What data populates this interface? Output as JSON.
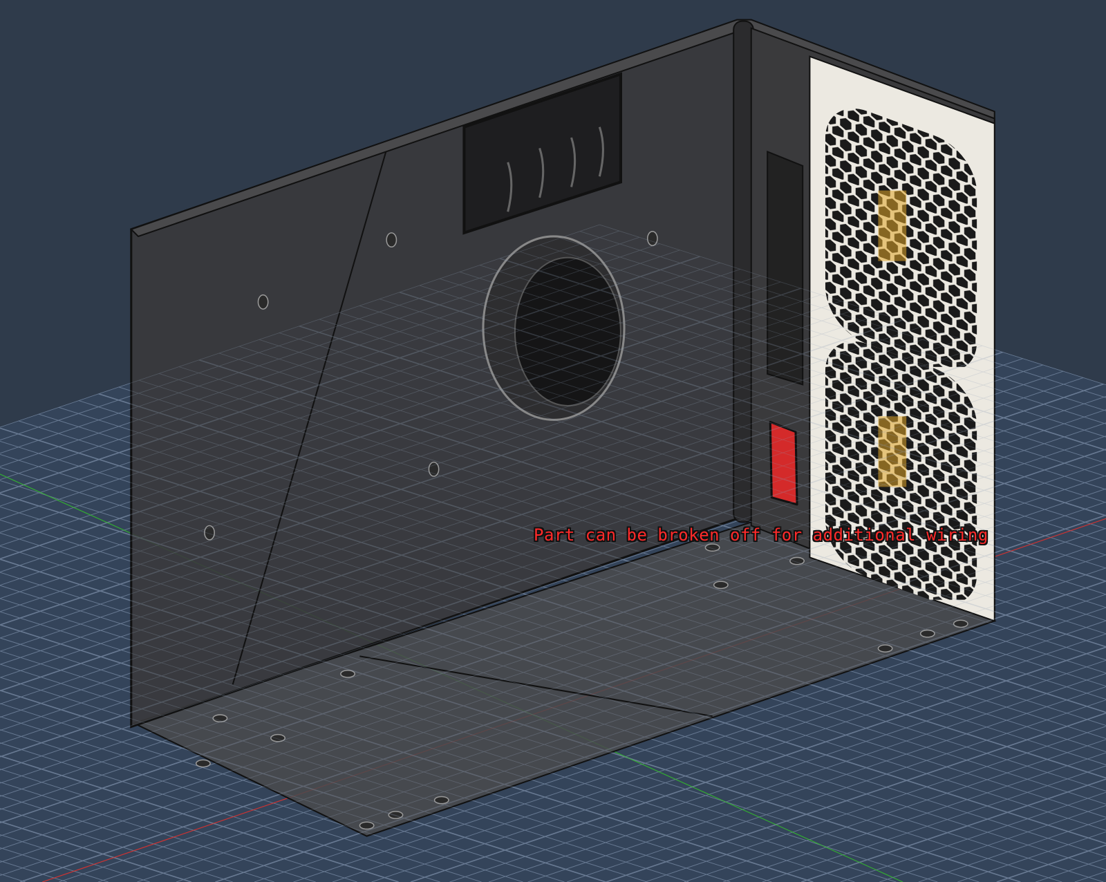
{
  "annotation": {
    "text": "Part can be broken off for additional wiring",
    "color": "#ff2a2a"
  },
  "colors": {
    "background": "#2f3b4b",
    "body": "#3a3a3c",
    "panel": "#ece9e1",
    "button": "#d42a2a",
    "accent": "#e0a62a"
  }
}
